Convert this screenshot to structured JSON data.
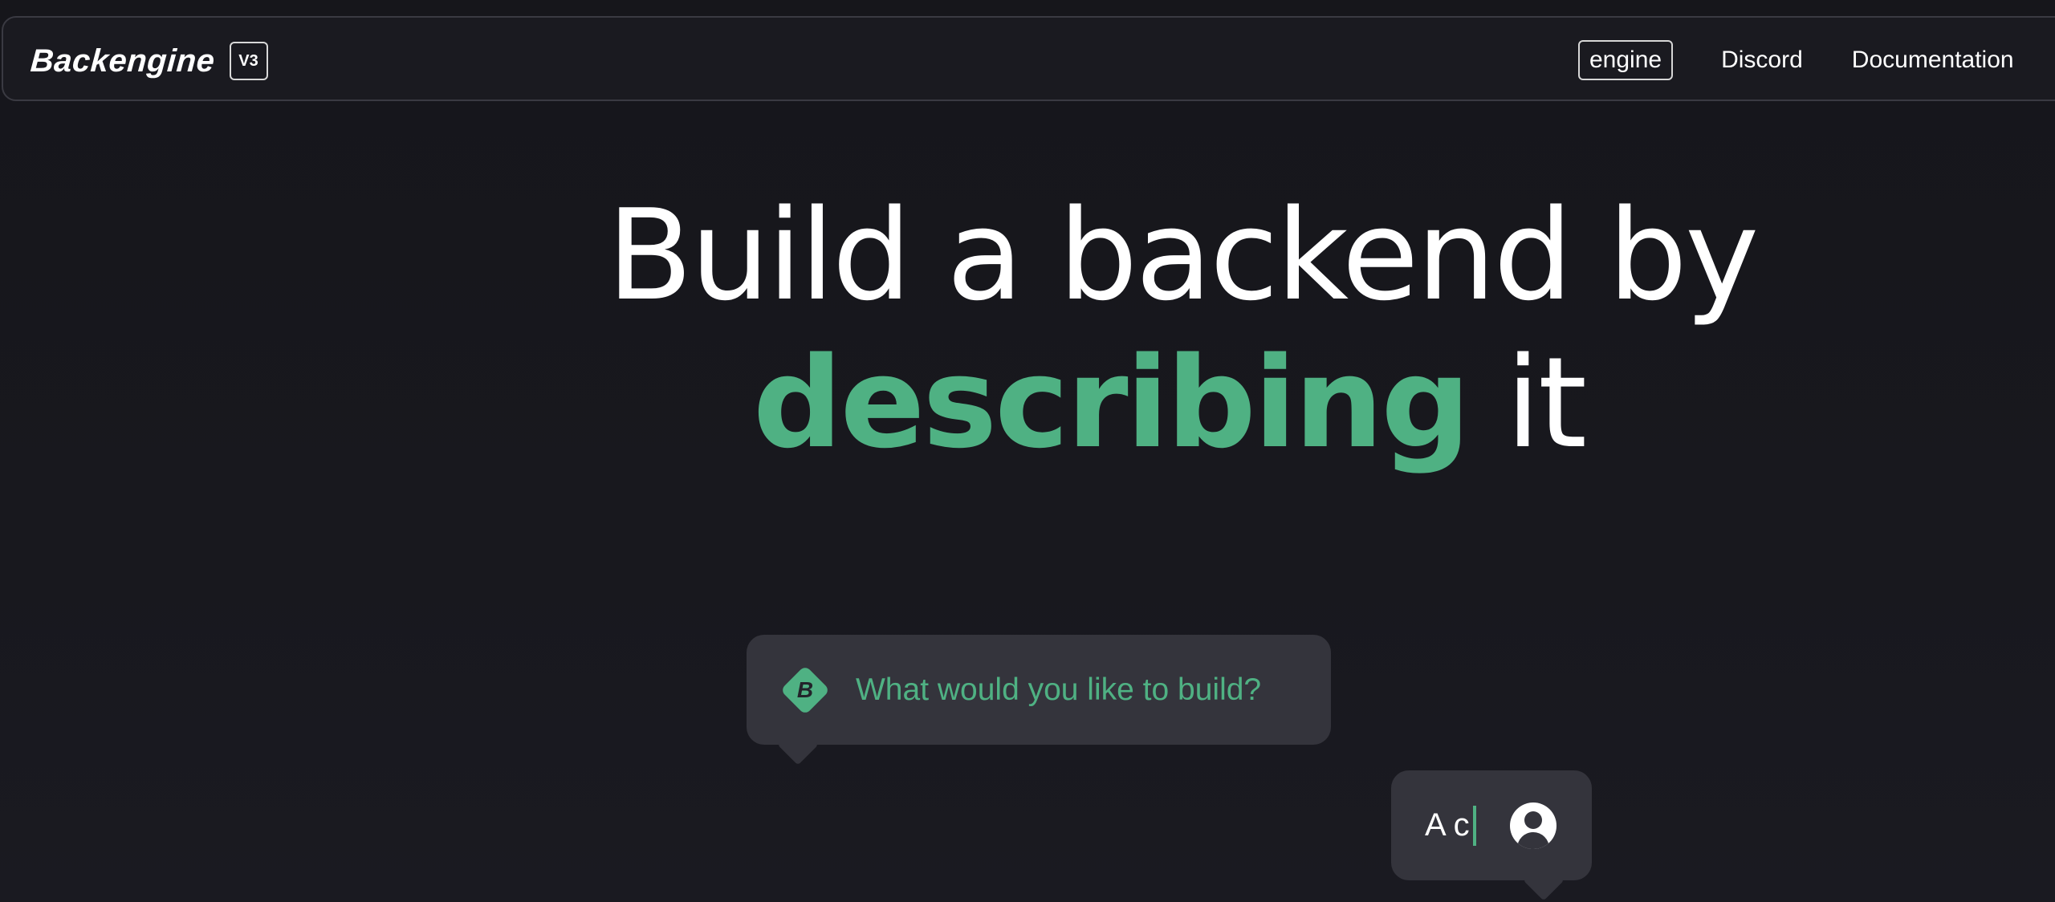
{
  "header": {
    "brand": "Backengine",
    "version_badge": "V3",
    "nav": {
      "engine": "engine",
      "discord": "Discord",
      "documentation": "Documentation"
    }
  },
  "hero": {
    "line1": "Build a backend by",
    "line2_accent": "describing",
    "line2_rest": " it"
  },
  "chat": {
    "bot_prompt": "What would you like to build?",
    "bot_icon_letter": "B",
    "user_typing": "A c"
  },
  "colors": {
    "accent": "#4fb183",
    "background": "#17171d",
    "bubble": "#34343c",
    "text": "#ffffff"
  },
  "icons": {
    "bot": "backengine-diamond-icon",
    "user": "user-avatar-icon"
  }
}
